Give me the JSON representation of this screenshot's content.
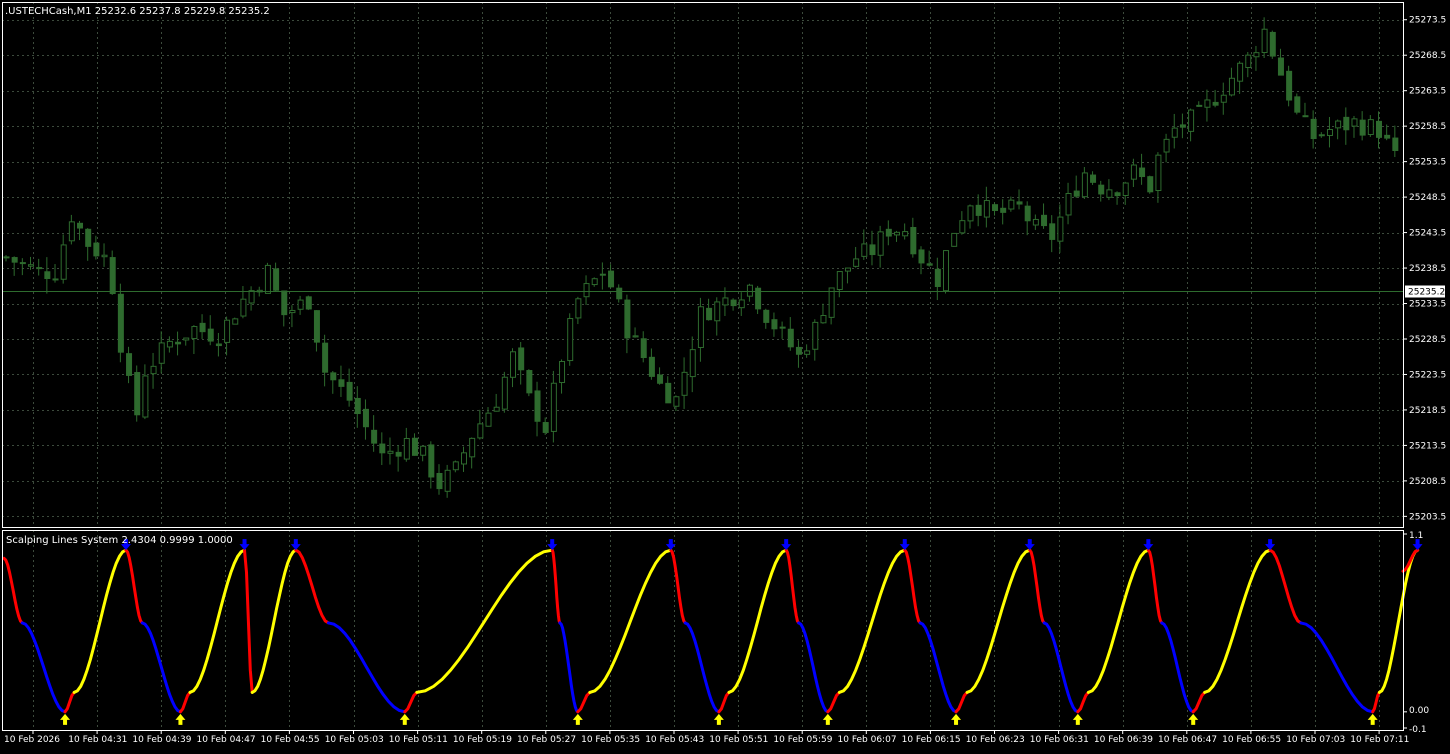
{
  "main_header": ".USTECHCash,M1  25232.6 25237.8 25229.8 25235.2",
  "indicator_header": "Scalping Lines System 2.4304 0.9999 1.0000",
  "current_price_label": "25235.2",
  "colors": {
    "background": "#000000",
    "grid": "#3c4a3c",
    "candle": "#2e6b2e",
    "axis": "#ffffff",
    "price_line": "#2e6b2e",
    "rising": "#ffff00",
    "falling": "#ff0000",
    "bottom": "#0000ff",
    "arrow_up": "#ffff00",
    "arrow_down": "#0000ff"
  },
  "chart_data": [
    {
      "type": "candlestick",
      "title": ".USTECHCash,M1",
      "ohlc_last": {
        "open": 25232.6,
        "high": 25237.8,
        "low": 25229.8,
        "close": 25235.2
      },
      "ylim": [
        25202.0,
        25276.0
      ],
      "y_ticks": [
        "25273.5",
        "25268.5",
        "25263.5",
        "25258.5",
        "25253.5",
        "25248.5",
        "25243.5",
        "25238.5",
        "25233.5",
        "25228.5",
        "25223.5",
        "25218.5",
        "25213.5",
        "25208.5",
        "25203.5"
      ],
      "x_ticks": [
        "10 Feb 2026",
        "10 Feb 04:31",
        "10 Feb 04:39",
        "10 Feb 04:47",
        "10 Feb 04:55",
        "10 Feb 05:03",
        "10 Feb 05:11",
        "10 Feb 05:19",
        "10 Feb 05:27",
        "10 Feb 05:35",
        "10 Feb 05:43",
        "10 Feb 05:51",
        "10 Feb 05:59",
        "10 Feb 06:07",
        "10 Feb 06:15",
        "10 Feb 06:23",
        "10 Feb 06:31",
        "10 Feb 06:39",
        "10 Feb 06:47",
        "10 Feb 06:55",
        "10 Feb 07:03",
        "10 Feb 07:11"
      ],
      "close_path": [
        [
          0,
          25240
        ],
        [
          4,
          25238
        ],
        [
          6,
          25238
        ],
        [
          8,
          25246
        ],
        [
          10,
          25242
        ],
        [
          12,
          25240
        ],
        [
          13,
          25236
        ],
        [
          14,
          25228
        ],
        [
          15,
          25222
        ],
        [
          16,
          25218
        ],
        [
          17,
          25224
        ],
        [
          20,
          25228
        ],
        [
          23,
          25230
        ],
        [
          26,
          25229
        ],
        [
          29,
          25234
        ],
        [
          32,
          25238
        ],
        [
          34,
          25232
        ],
        [
          37,
          25234
        ],
        [
          39,
          25224
        ],
        [
          42,
          25220
        ],
        [
          44,
          25216
        ],
        [
          46,
          25212
        ],
        [
          49,
          25214
        ],
        [
          51,
          25212
        ],
        [
          53,
          25208
        ],
        [
          55,
          25210
        ],
        [
          57,
          25215
        ],
        [
          60,
          25220
        ],
        [
          62,
          25226
        ],
        [
          64,
          25220
        ],
        [
          66,
          25216
        ],
        [
          68,
          25226
        ],
        [
          70,
          25234
        ],
        [
          73,
          25238
        ],
        [
          74,
          25236
        ],
        [
          76,
          25230
        ],
        [
          78,
          25226
        ],
        [
          80,
          25222
        ],
        [
          82,
          25220
        ],
        [
          85,
          25232
        ],
        [
          88,
          25234
        ],
        [
          91,
          25236
        ],
        [
          93,
          25232
        ],
        [
          95,
          25229
        ],
        [
          97,
          25226
        ],
        [
          99,
          25230
        ],
        [
          101,
          25236
        ],
        [
          104,
          25240
        ],
        [
          106,
          25241
        ],
        [
          108,
          25244
        ],
        [
          110,
          25244
        ],
        [
          112,
          25240
        ],
        [
          114,
          25237
        ],
        [
          116,
          25244
        ],
        [
          118,
          25248
        ],
        [
          121,
          25246
        ],
        [
          124,
          25247
        ],
        [
          126,
          25244
        ],
        [
          128,
          25243
        ],
        [
          130,
          25248
        ],
        [
          132,
          25252
        ],
        [
          134,
          25250
        ],
        [
          136,
          25250
        ],
        [
          138,
          25252
        ],
        [
          140,
          25250
        ],
        [
          141,
          25254
        ],
        [
          143,
          25258
        ],
        [
          146,
          25260
        ],
        [
          149,
          25264
        ],
        [
          152,
          25268
        ],
        [
          154,
          25272
        ],
        [
          156,
          25266
        ],
        [
          158,
          25260
        ],
        [
          160,
          25257
        ],
        [
          162,
          25258
        ],
        [
          165,
          25259
        ],
        [
          168,
          25258
        ],
        [
          170,
          25254
        ]
      ]
    },
    {
      "type": "line",
      "title": "Scalping Lines System",
      "values": [
        2.4304,
        0.9999,
        1.0
      ],
      "ylim": [
        -0.1,
        1.1
      ],
      "y_ticks": [
        "1.1",
        "0.00",
        "-0.1"
      ],
      "color_segments": [
        "yellow rising",
        "red falling",
        "blue bottom"
      ],
      "cycle_peaks_x_ticks_index": [
        1.5,
        3.5,
        4.2,
        8.2,
        10.1,
        11.9,
        13.8,
        15.7,
        17.5,
        19.3,
        21.6
      ],
      "buy_arrows_x_ticks_index": [
        0.5,
        2.3,
        5.8,
        8.5,
        10.7,
        12.4,
        14.4,
        16.3,
        18.1,
        20.9
      ],
      "sell_arrows_x_ticks_index": [
        1.45,
        3.3,
        4.1,
        8.1,
        9.95,
        11.75,
        13.6,
        15.55,
        17.4,
        19.3,
        21.6
      ]
    }
  ]
}
